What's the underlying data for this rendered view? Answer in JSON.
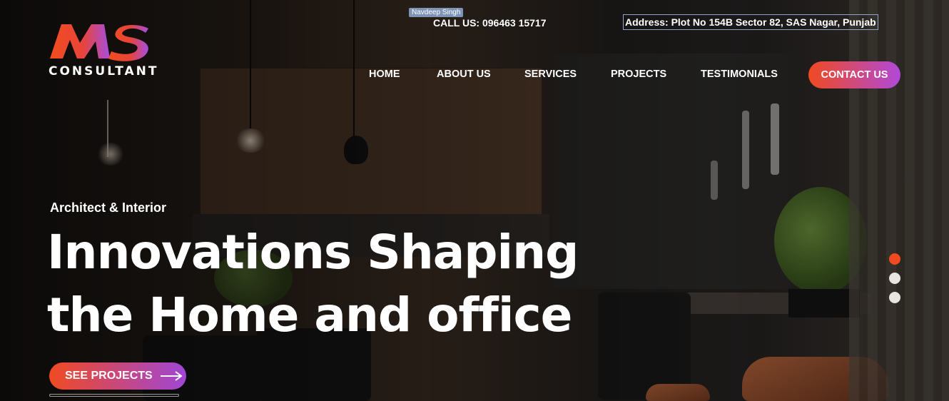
{
  "brand": {
    "logo_letters": "MS",
    "logo_text": "CONSULTANT"
  },
  "topbar": {
    "tooltip": "Navdeep Singh",
    "call": "CALL US: 096463 15717",
    "address": "Address: Plot No 154B Sector 82, SAS Nagar,  Punjab"
  },
  "nav": {
    "items": [
      {
        "label": "HOME"
      },
      {
        "label": "ABOUT US"
      },
      {
        "label": "SERVICES"
      },
      {
        "label": "PROJECTS"
      },
      {
        "label": "TESTIMONIALS"
      }
    ],
    "contact": "CONTACT US"
  },
  "hero": {
    "eyebrow": "Architect  & Interior",
    "headline_line1": "Innovations Shaping",
    "headline_line2": "the Home and office",
    "cta": "SEE PROJECTS",
    "cta_icon": "arrow-right-icon"
  },
  "slider": {
    "slides": 3,
    "active": 1
  },
  "colors": {
    "accent_start": "#f04a21",
    "accent_end": "#b049d8",
    "text": "#ffffff"
  }
}
